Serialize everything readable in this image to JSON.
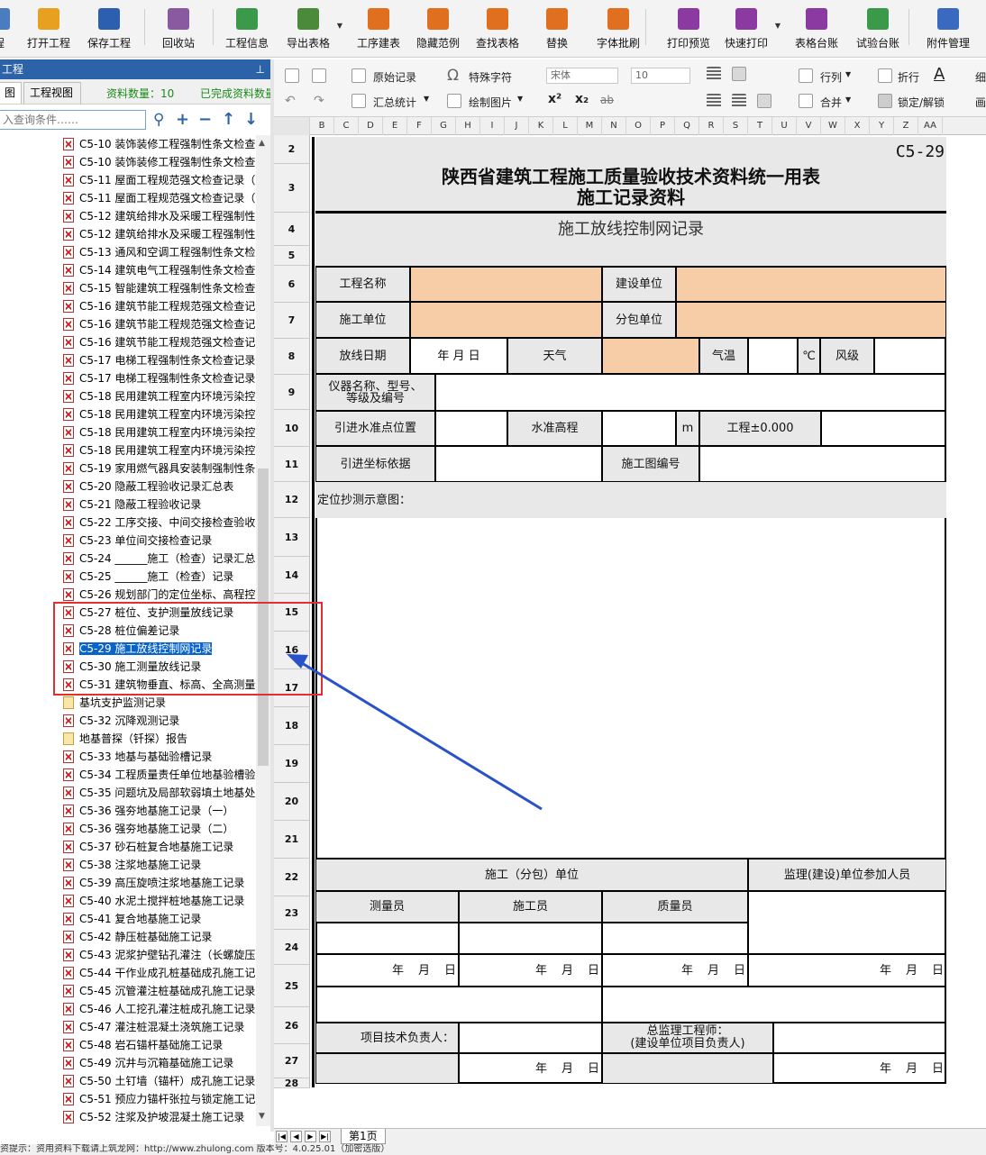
{
  "toolbar": {
    "items": [
      {
        "label": "程",
        "icon": "cut-off-icon",
        "color": "#4a7cc0"
      },
      {
        "label": "打开工程",
        "icon": "folder-open-icon",
        "color": "#e8a020"
      },
      {
        "label": "保存工程",
        "icon": "save-icon",
        "color": "#2c5fb0"
      },
      {
        "label": "回收站",
        "icon": "trash-icon",
        "color": "#8a5aa0"
      },
      {
        "label": "工程信息",
        "icon": "info-icon",
        "color": "#3a9a4a"
      },
      {
        "label": "导出表格",
        "icon": "export-table-icon",
        "color": "#4a8a3a"
      },
      {
        "label": "工序建表",
        "icon": "layers-icon",
        "color": "#e07020"
      },
      {
        "label": "隐藏范例",
        "icon": "sample-icon",
        "color": "#e07020"
      },
      {
        "label": "查找表格",
        "icon": "search-table-icon",
        "color": "#e07020"
      },
      {
        "label": "替换",
        "icon": "replace-icon",
        "color": "#e07020"
      },
      {
        "label": "字体批刷",
        "icon": "font-brush-icon",
        "color": "#e07020"
      },
      {
        "label": "打印预览",
        "icon": "print-preview-icon",
        "color": "#8a3aa0"
      },
      {
        "label": "快速打印",
        "icon": "printer-icon",
        "color": "#8a3aa0"
      },
      {
        "label": "表格台账",
        "icon": "ledger-icon",
        "color": "#8a3aa0"
      },
      {
        "label": "试验台账",
        "icon": "test-ledger-icon",
        "color": "#3a9a4a"
      },
      {
        "label": "附件管理",
        "icon": "paperclip-icon",
        "color": "#3a6ac0"
      }
    ]
  },
  "left_panel": {
    "title": "工程",
    "tabs": [
      "图",
      "工程视图"
    ],
    "data_count": "资料数量：10",
    "completed": "已完成资料数量",
    "search_placeholder": "入查询条件……",
    "tree_items": [
      {
        "text": "C5-10  装饰装修工程强制性条文检查",
        "type": "x"
      },
      {
        "text": "C5-10  装饰装修工程强制性条文检查",
        "type": "x"
      },
      {
        "text": "C5-11  屋面工程规范强文检查记录（",
        "type": "x"
      },
      {
        "text": "C5-11  屋面工程规范强文检查记录（",
        "type": "x"
      },
      {
        "text": "C5-12  建筑给排水及采暖工程强制性",
        "type": "x"
      },
      {
        "text": "C5-12  建筑给排水及采暖工程强制性",
        "type": "x"
      },
      {
        "text": "C5-13  通风和空调工程强制性条文检",
        "type": "x"
      },
      {
        "text": "C5-14  建筑电气工程强制性条文检查",
        "type": "x"
      },
      {
        "text": "C5-15  智能建筑工程强制性条文检查",
        "type": "x"
      },
      {
        "text": "C5-16  建筑节能工程规范强文检查记",
        "type": "x"
      },
      {
        "text": "C5-16  建筑节能工程规范强文检查记",
        "type": "x"
      },
      {
        "text": "C5-16  建筑节能工程规范强文检查记",
        "type": "x"
      },
      {
        "text": "C5-17  电梯工程强制性条文检查记录",
        "type": "x"
      },
      {
        "text": "C5-17  电梯工程强制性条文检查记录",
        "type": "x"
      },
      {
        "text": "C5-18  民用建筑工程室内环境污染控",
        "type": "x"
      },
      {
        "text": "C5-18  民用建筑工程室内环境污染控",
        "type": "x"
      },
      {
        "text": "C5-18  民用建筑工程室内环境污染控",
        "type": "x"
      },
      {
        "text": "C5-18  民用建筑工程室内环境污染控",
        "type": "x"
      },
      {
        "text": "C5-19  家用燃气器具安装制强制性条",
        "type": "x"
      },
      {
        "text": "C5-20  隐蔽工程验收记录汇总表",
        "type": "x"
      },
      {
        "text": "C5-21  隐蔽工程验收记录",
        "type": "x"
      },
      {
        "text": "C5-22  工序交接、中间交接检查验收",
        "type": "x"
      },
      {
        "text": "C5-23  单位间交接检查记录",
        "type": "x"
      },
      {
        "text": "C5-24  ______施工（检查）记录汇总",
        "type": "x"
      },
      {
        "text": "C5-25  ______施工（检查）记录",
        "type": "x"
      },
      {
        "text": "C5-26  规划部门的定位坐标、高程控",
        "type": "x"
      },
      {
        "text": "C5-27  桩位、支护测量放线记录",
        "type": "x"
      },
      {
        "text": "C5-28  桩位偏差记录",
        "type": "x"
      },
      {
        "text": "C5-29  施工放线控制网记录",
        "type": "x",
        "selected": true
      },
      {
        "text": "C5-30  施工测量放线记录",
        "type": "x"
      },
      {
        "text": "C5-31  建筑物垂直、标高、全高测量",
        "type": "x"
      },
      {
        "text": "基坑支护监测记录",
        "type": "folder"
      },
      {
        "text": "C5-32  沉降观测记录",
        "type": "x"
      },
      {
        "text": "地基普探（钎探）报告",
        "type": "folder"
      },
      {
        "text": "C5-33  地基与基础验槽记录",
        "type": "x"
      },
      {
        "text": "C5-34  工程质量责任单位地基验槽验",
        "type": "x"
      },
      {
        "text": "C5-35  问题坑及局部软弱填土地基处",
        "type": "x"
      },
      {
        "text": "C5-36  强夯地基施工记录（一）",
        "type": "x"
      },
      {
        "text": "C5-36  强夯地基施工记录（二）",
        "type": "x"
      },
      {
        "text": "C5-37  砂石桩复合地基施工记录",
        "type": "x"
      },
      {
        "text": "C5-38  注浆地基施工记录",
        "type": "x"
      },
      {
        "text": "C5-39  高压旋喷注浆地基施工记录",
        "type": "x"
      },
      {
        "text": "C5-40  水泥土搅拌桩地基施工记录",
        "type": "x"
      },
      {
        "text": "C5-41  复合地基施工记录",
        "type": "x"
      },
      {
        "text": "C5-42  静压桩基础施工记录",
        "type": "x"
      },
      {
        "text": "C5-43  泥浆护壁钻孔灌注（长螺旋压",
        "type": "x"
      },
      {
        "text": "C5-44  干作业成孔桩基础成孔施工记",
        "type": "x"
      },
      {
        "text": "C5-45  沉管灌注桩基础成孔施工记录",
        "type": "x"
      },
      {
        "text": "C5-46  人工挖孔灌注桩成孔施工记录",
        "type": "x"
      },
      {
        "text": "C5-47  灌注桩混凝土浇筑施工记录",
        "type": "x"
      },
      {
        "text": "C5-48  岩石锚杆基础施工记录",
        "type": "x"
      },
      {
        "text": "C5-49  沉井与沉箱基础施工记录",
        "type": "x"
      },
      {
        "text": "C5-50  土钉墙（锚杆）成孔施工记录",
        "type": "x"
      },
      {
        "text": "C5-51  预应力锚杆张拉与锁定施工记",
        "type": "x"
      },
      {
        "text": "C5-52  注浆及护坡混凝土施工记录",
        "type": "x"
      }
    ]
  },
  "ribbon": {
    "original_record": "原始记录",
    "special_char": "特殊字符",
    "summary_stats": "汇总统计",
    "draw_picture": "绘制图片",
    "font_name": "宋体",
    "font_size": "10",
    "row_col": "行列",
    "fold_row": "折行",
    "merge": "合并",
    "lock_unlock": "锁定/解锁",
    "superscript": "x²",
    "subscript": "x₂",
    "strike": "ab",
    "font_color_glyph": "A",
    "right_clip1": "细",
    "right_clip2": "画"
  },
  "sheet": {
    "columns": [
      "B",
      "C",
      "D",
      "E",
      "F",
      "G",
      "H",
      "I",
      "J",
      "K",
      "L",
      "M",
      "N",
      "O",
      "P",
      "Q",
      "R",
      "S",
      "T",
      "U",
      "V",
      "W",
      "X",
      "Y",
      "Z",
      "AA"
    ],
    "rows": [
      "2",
      "3",
      "4",
      "5",
      "6",
      "7",
      "8",
      "9",
      "10",
      "11",
      "12",
      "13",
      "14",
      "15",
      "16",
      "17",
      "18",
      "19",
      "20",
      "21",
      "22",
      "23",
      "24",
      "25",
      "26",
      "27",
      "28"
    ],
    "code": "C5-29",
    "title1": "陕西省建筑工程施工质量验收技术资料统一用表",
    "title2": "施工记录资料",
    "subtitle": "施工放线控制网记录",
    "project_name": "工程名称",
    "build_unit": "建设单位",
    "construction_unit": "施工单位",
    "sub_unit": "分包单位",
    "setout_date": "放线日期",
    "date_placeholder": "年  月  日",
    "weather": "天气",
    "temperature": "气温",
    "celsius": "℃",
    "wind": "风级",
    "instrument": "仪器名称、型号、等级及编号",
    "benchmark_pos": "引进水准点位置",
    "benchmark_elev": "水准高程",
    "unit_m": "m",
    "project_zero": "工程±0.000",
    "coord_basis": "引进坐标依据",
    "drawing_no": "施工图编号",
    "diagram_label": "定位抄测示意图：",
    "construction_sub": "施工（分包）单位",
    "supervision": "监理(建设)单位参加人员",
    "surveyor": "测量员",
    "builder": "施工员",
    "quality": "质量员",
    "date_y": "年",
    "date_m": "月",
    "date_d": "日",
    "tech_lead": "项目技术负责人：",
    "chief_supervisor": "总监理工程师：",
    "chief_supervisor2": "(建设单位项目负责人)"
  },
  "sheet_tabs": {
    "current": "第1页"
  },
  "status_bar": {
    "text": "资提示：资用资料下载请上筑龙网：http://www.zhulong.com       版本号：4.0.25.01（加密选版）"
  },
  "colors": {
    "accent": "#2b62a8",
    "peach": "#f6cda6",
    "gray_cell": "#e8e8e8",
    "highlight_box": "#e03030",
    "arrow": "#2a52c8"
  }
}
